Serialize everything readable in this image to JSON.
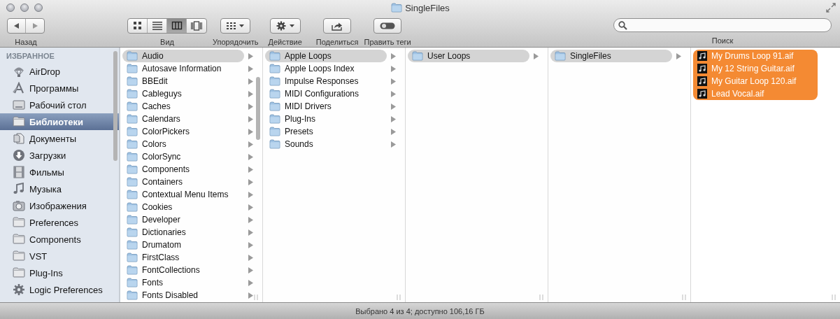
{
  "window": {
    "title": "SingleFiles"
  },
  "toolbar": {
    "back": {
      "label": "Назад"
    },
    "view": {
      "label": "Вид",
      "modes": [
        {
          "kind": "icons",
          "selected": false
        },
        {
          "kind": "list",
          "selected": false
        },
        {
          "kind": "columns",
          "selected": true
        },
        {
          "kind": "coverflow",
          "selected": false
        }
      ]
    },
    "arrange": {
      "label": "Упорядочить"
    },
    "action": {
      "label": "Действие"
    },
    "share": {
      "label": "Поделиться"
    },
    "tags": {
      "label": "Править теги"
    },
    "search": {
      "label": "Поиск"
    }
  },
  "sidebar": {
    "heading": "ИЗБРАННОЕ",
    "items": [
      {
        "label": "AirDrop",
        "kind": "airdrop",
        "selected": false
      },
      {
        "label": "Программы",
        "kind": "apps",
        "selected": false
      },
      {
        "label": "Рабочий стол",
        "kind": "desktop",
        "selected": false
      },
      {
        "label": "Библиотеки",
        "kind": "folder",
        "selected": true
      },
      {
        "label": "Документы",
        "kind": "documents",
        "selected": false
      },
      {
        "label": "Загрузки",
        "kind": "downloads",
        "selected": false
      },
      {
        "label": "Фильмы",
        "kind": "movies",
        "selected": false
      },
      {
        "label": "Музыка",
        "kind": "music",
        "selected": false
      },
      {
        "label": "Изображения",
        "kind": "pictures",
        "selected": false
      },
      {
        "label": "Preferences",
        "kind": "folder",
        "selected": false
      },
      {
        "label": "Components",
        "kind": "folder",
        "selected": false
      },
      {
        "label": "VST",
        "kind": "folder",
        "selected": false
      },
      {
        "label": "Plug-Ins",
        "kind": "folder",
        "selected": false
      },
      {
        "label": "Logic Preferences",
        "kind": "gear",
        "selected": false
      }
    ]
  },
  "columns": [
    {
      "focused": false,
      "items": [
        {
          "label": "Audio",
          "kind": "folder",
          "selected": true,
          "has_children": true
        },
        {
          "label": "Autosave Information",
          "kind": "folder",
          "selected": false,
          "has_children": true
        },
        {
          "label": "BBEdit",
          "kind": "folder",
          "selected": false,
          "has_children": true
        },
        {
          "label": "Cableguys",
          "kind": "folder",
          "selected": false,
          "has_children": true
        },
        {
          "label": "Caches",
          "kind": "folder",
          "selected": false,
          "has_children": true
        },
        {
          "label": "Calendars",
          "kind": "folder",
          "selected": false,
          "has_children": true
        },
        {
          "label": "ColorPickers",
          "kind": "folder",
          "selected": false,
          "has_children": true
        },
        {
          "label": "Colors",
          "kind": "folder",
          "selected": false,
          "has_children": true
        },
        {
          "label": "ColorSync",
          "kind": "folder",
          "selected": false,
          "has_children": true
        },
        {
          "label": "Components",
          "kind": "folder",
          "selected": false,
          "has_children": true
        },
        {
          "label": "Containers",
          "kind": "folder",
          "selected": false,
          "has_children": true
        },
        {
          "label": "Contextual Menu Items",
          "kind": "folder",
          "selected": false,
          "has_children": true
        },
        {
          "label": "Cookies",
          "kind": "folder",
          "selected": false,
          "has_children": true
        },
        {
          "label": "Developer",
          "kind": "folder",
          "selected": false,
          "has_children": true
        },
        {
          "label": "Dictionaries",
          "kind": "folder",
          "selected": false,
          "has_children": true
        },
        {
          "label": "Drumatom",
          "kind": "folder",
          "selected": false,
          "has_children": true
        },
        {
          "label": "FirstClass",
          "kind": "folder",
          "selected": false,
          "has_children": true
        },
        {
          "label": "FontCollections",
          "kind": "folder",
          "selected": false,
          "has_children": true
        },
        {
          "label": "Fonts",
          "kind": "folder",
          "selected": false,
          "has_children": true
        },
        {
          "label": "Fonts Disabled",
          "kind": "folder",
          "selected": false,
          "has_children": true
        }
      ]
    },
    {
      "focused": false,
      "items": [
        {
          "label": "Apple Loops",
          "kind": "folder",
          "selected": true,
          "has_children": true
        },
        {
          "label": "Apple Loops Index",
          "kind": "folder",
          "selected": false,
          "has_children": true
        },
        {
          "label": "Impulse Responses",
          "kind": "folder",
          "selected": false,
          "has_children": true
        },
        {
          "label": "MIDI Configurations",
          "kind": "folder",
          "selected": false,
          "has_children": true
        },
        {
          "label": "MIDI Drivers",
          "kind": "folder",
          "selected": false,
          "has_children": true
        },
        {
          "label": "Plug-Ins",
          "kind": "folder",
          "selected": false,
          "has_children": true
        },
        {
          "label": "Presets",
          "kind": "folder",
          "selected": false,
          "has_children": true
        },
        {
          "label": "Sounds",
          "kind": "folder",
          "selected": false,
          "has_children": true
        }
      ]
    },
    {
      "focused": false,
      "items": [
        {
          "label": "User Loops",
          "kind": "folder",
          "selected": true,
          "has_children": true
        }
      ]
    },
    {
      "focused": false,
      "items": [
        {
          "label": "SingleFiles",
          "kind": "folder",
          "selected": true,
          "has_children": true
        }
      ]
    },
    {
      "focused": true,
      "items": [
        {
          "label": "My Drums Loop 91.aif",
          "kind": "audio",
          "selected": true,
          "has_children": false
        },
        {
          "label": "My 12 String Guitar.aif",
          "kind": "audio",
          "selected": true,
          "has_children": false
        },
        {
          "label": "My Guitar Loop 120.aif",
          "kind": "audio",
          "selected": true,
          "has_children": false
        },
        {
          "label": "Lead Vocal.aif",
          "kind": "audio",
          "selected": true,
          "has_children": false
        }
      ]
    }
  ],
  "status_bar": "Выбрано 4 из 4; доступно 106,16 ГБ"
}
